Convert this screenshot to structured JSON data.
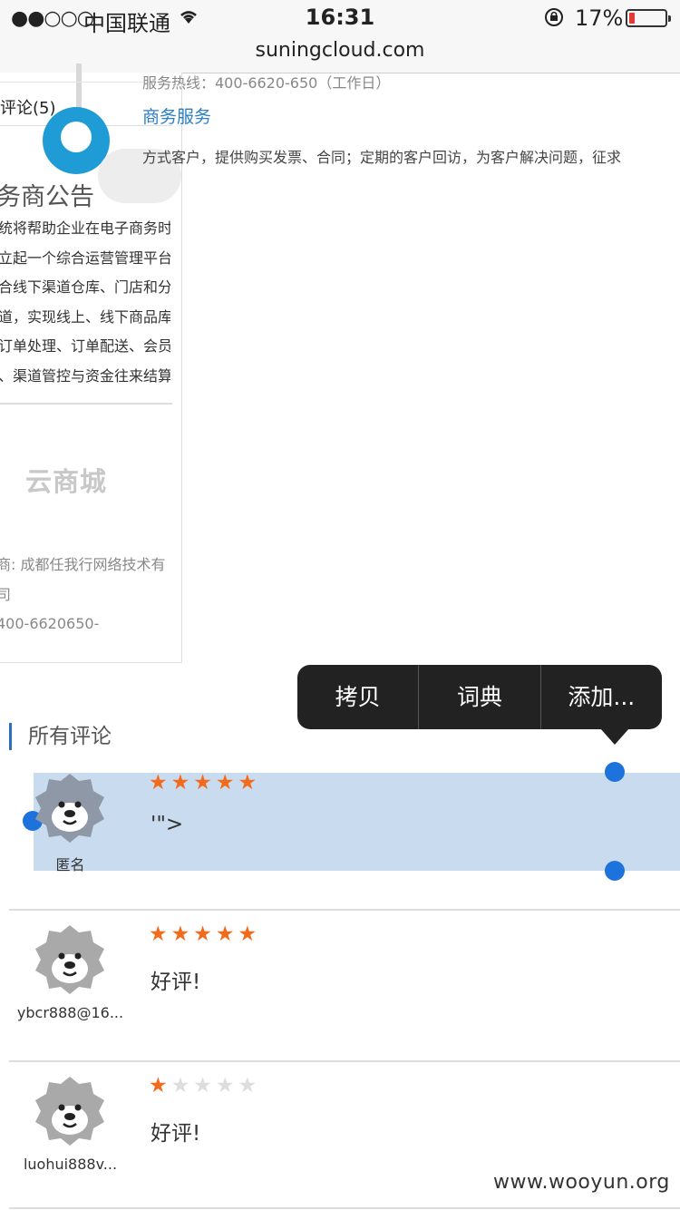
{
  "status_bar": {
    "signal": "●●○○○",
    "carrier": "中国联通",
    "time": "16:31",
    "battery_pct": "17%",
    "battery_level": 0.17,
    "icons": [
      "wifi-icon",
      "orientation-lock-icon",
      "battery-icon"
    ]
  },
  "browser": {
    "url": "suningcloud.com"
  },
  "left_panel": {
    "tab": "评论(5)",
    "title": "务商公告",
    "announcement_lines": [
      "统将帮助企业在电子商务时",
      "立起一个综合运营管理平台",
      "合线下渠道仓库、门店和分",
      "道，实现线上、线下商品库",
      "订单处理、订单配送、会员",
      "、渠道管控与资金往来结算"
    ],
    "logo": "云商城",
    "provider": "商: 成都任我行网络技术有",
    "provider_cont": "司",
    "phone": "400-6620650-"
  },
  "service": {
    "hotline": "服务热线：400-6620-650（工作日）",
    "link": "商务服务",
    "description": "方式客户，提供购买发票、合同；定期的客户回访，为客户解决问题，征求"
  },
  "context_menu": {
    "items": [
      "拷贝",
      "词典",
      "添加..."
    ]
  },
  "reviews": {
    "header": "所有评论",
    "items": [
      {
        "name": "匿名",
        "rating": 5,
        "text": "'\">"
      },
      {
        "name": "ybcr888@16...",
        "rating": 5,
        "text": "好评!"
      },
      {
        "name": "luohui888v...",
        "rating": 1,
        "text": "好评!"
      }
    ]
  },
  "watermark": "www.wooyun.org",
  "colors": {
    "accent": "#2a7fc8",
    "star": "#f26a1b",
    "selection": "#c9dcef",
    "handle": "#1e72dc"
  }
}
